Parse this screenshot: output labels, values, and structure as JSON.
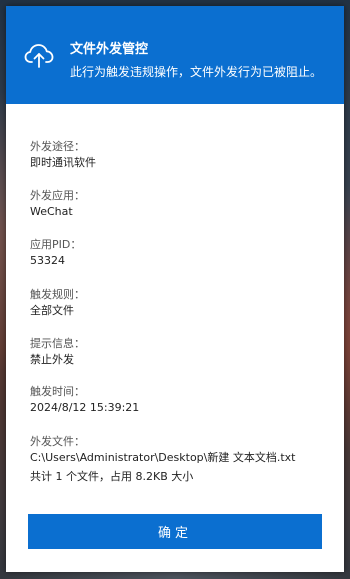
{
  "header": {
    "title": "文件外发管控",
    "subtitle": "此行为触发违规操作，文件外发行为已被阻止。",
    "icon": "cloud-upload-icon"
  },
  "fields": {
    "path": {
      "label": "外发途径：",
      "value": "即时通讯软件"
    },
    "app": {
      "label": "外发应用：",
      "value": "WeChat"
    },
    "pid": {
      "label": "应用PID：",
      "value": "53324"
    },
    "rule": {
      "label": "触发规则：",
      "value": "全部文件"
    },
    "hint": {
      "label": "提示信息：",
      "value": "禁止外发"
    },
    "time": {
      "label": "触发时间：",
      "value": "2024/8/12 15:39:21"
    },
    "file": {
      "label": "外发文件：",
      "value": "C:\\Users\\Administrator\\Desktop\\新建 文本文档.txt",
      "summary": "共计 1 个文件，占用 8.2KB 大小"
    }
  },
  "ok_button": {
    "label": "确定"
  },
  "colors": {
    "accent": "#0b6fd0"
  }
}
